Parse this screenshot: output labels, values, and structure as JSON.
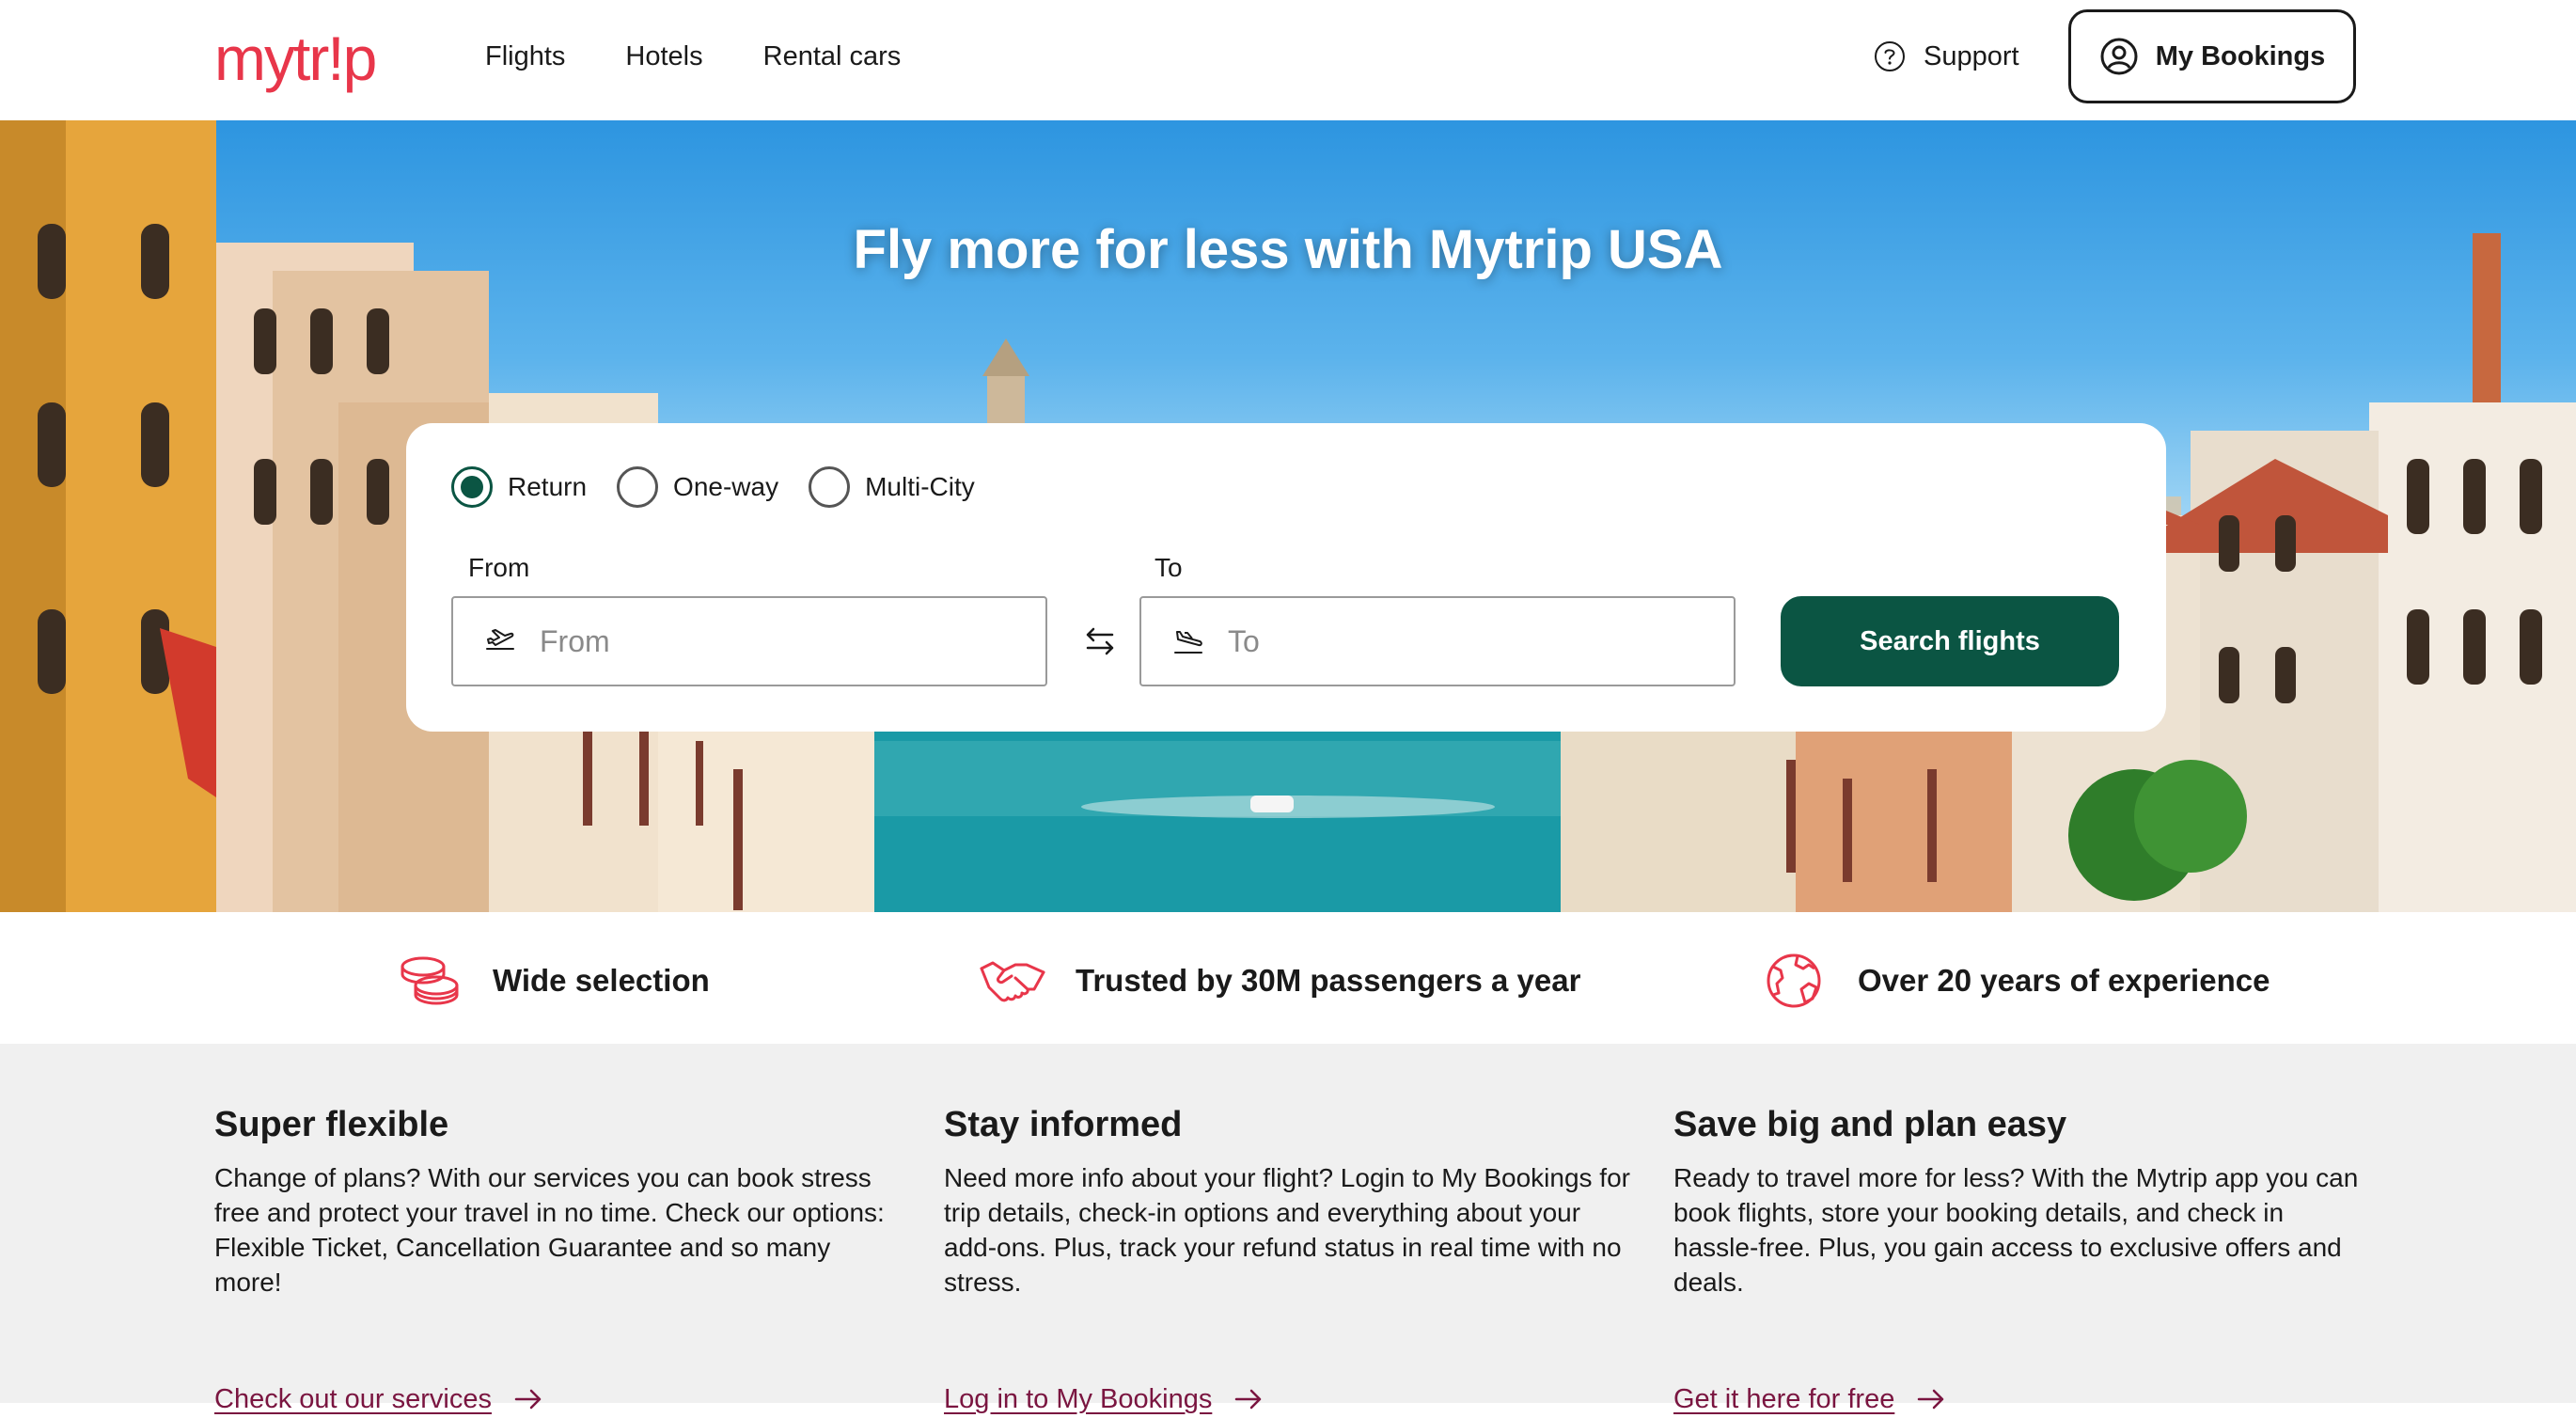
{
  "header": {
    "logo": "mytr!p",
    "nav": [
      "Flights",
      "Hotels",
      "Rental cars"
    ],
    "support_label": "Support",
    "bookings_label": "My Bookings"
  },
  "hero": {
    "title": "Fly more for less with Mytrip USA"
  },
  "search": {
    "trip_types": [
      {
        "label": "Return",
        "selected": true
      },
      {
        "label": "One-way",
        "selected": false
      },
      {
        "label": "Multi-City",
        "selected": false
      }
    ],
    "from_label": "From",
    "from_placeholder": "From",
    "from_value": "",
    "to_label": "To",
    "to_placeholder": "To",
    "to_value": "",
    "button_label": "Search flights"
  },
  "usps": [
    {
      "icon": "coins-icon",
      "text": "Wide selection"
    },
    {
      "icon": "handshake-icon",
      "text": "Trusted by 30M passengers a year"
    },
    {
      "icon": "globe-icon",
      "text": "Over 20 years of experience"
    }
  ],
  "info": [
    {
      "title": "Super flexible",
      "body": "Change of plans? With our services you can book stress free and protect your travel in no time. Check our options: Flexible Ticket, Cancellation Guarantee and so many more!",
      "link": "Check out our services"
    },
    {
      "title": "Stay informed",
      "body": "Need more info about your flight? Login to My Bookings for trip details, check-in options and everything about your add-ons. Plus, track your refund status in real time with no stress.",
      "link": "Log in to My Bookings"
    },
    {
      "title": "Save big and plan easy",
      "body": "Ready to travel more for less? With the Mytrip app you can book flights, store your booking details, and check in hassle-free. Plus, you gain access to exclusive offers and deals.",
      "link": "Get it here for free"
    }
  ],
  "colors": {
    "brand": "#e8364a",
    "primary": "#0b5543",
    "link": "#7a1540",
    "section_bg": "#f0f0f0"
  }
}
